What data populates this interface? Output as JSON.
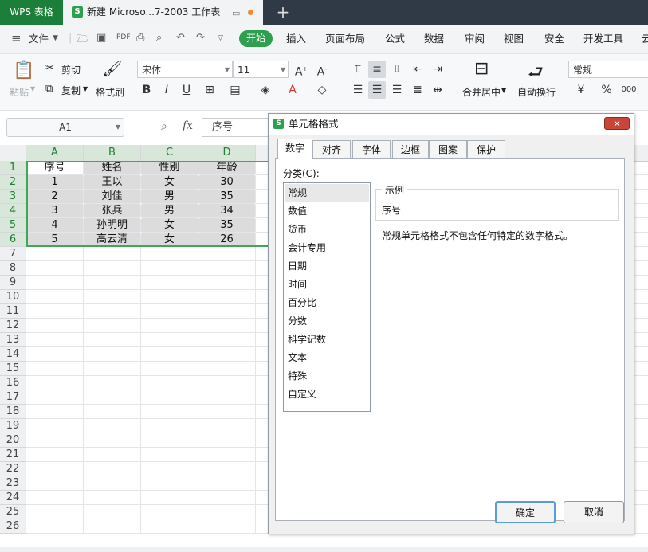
{
  "titlebar": {
    "app_tab": "WPS 表格",
    "doc_tab": "新建 Microso...7-2003 工作表",
    "new_tab_icon": "plus-icon",
    "doc_icon_letter": "S"
  },
  "menubar": {
    "file_label": "文件",
    "start_label": "开始",
    "items": [
      "插入",
      "页面布局",
      "公式",
      "数据",
      "审阅",
      "视图",
      "安全",
      "开发工具",
      "云"
    ]
  },
  "ribbon": {
    "paste_label": "粘贴",
    "cut_label": "剪切",
    "copy_label": "复制",
    "format_painter_label": "格式刷",
    "font_name": "宋体",
    "font_size": "11",
    "merge_center_label": "合并居中",
    "wrap_text_label": "自动换行",
    "number_format": "常规",
    "percent_label": "%"
  },
  "formula_bar": {
    "name_box": "A1",
    "fx_label": "fx",
    "formula_value": "序号"
  },
  "sheet": {
    "columns": [
      "A",
      "B",
      "C",
      "D"
    ],
    "row_numbers": [
      "1",
      "2",
      "3",
      "4",
      "5",
      "6",
      "7",
      "8",
      "9",
      "10",
      "11",
      "12",
      "13",
      "14",
      "15",
      "16",
      "17",
      "18",
      "19",
      "20",
      "21",
      "22",
      "23",
      "24",
      "25",
      "26"
    ],
    "headers": [
      "序号",
      "姓名",
      "性别",
      "年龄"
    ],
    "rows": [
      [
        "1",
        "王以",
        "女",
        "30"
      ],
      [
        "2",
        "刘佳",
        "男",
        "35"
      ],
      [
        "3",
        "张兵",
        "男",
        "34"
      ],
      [
        "4",
        "孙明明",
        "女",
        "35"
      ],
      [
        "5",
        "高云清",
        "女",
        "26"
      ]
    ]
  },
  "dialog": {
    "title": "单元格格式",
    "close_label": "×",
    "tabs": [
      "数字",
      "对齐",
      "字体",
      "边框",
      "图案",
      "保护"
    ],
    "category_label": "分类(C):",
    "categories": [
      "常规",
      "数值",
      "货币",
      "会计专用",
      "日期",
      "时间",
      "百分比",
      "分数",
      "科学记数",
      "文本",
      "特殊",
      "自定义"
    ],
    "sample_label": "示例",
    "sample_value": "序号",
    "description": "常规单元格格式不包含任何特定的数字格式。",
    "ok_label": "确定",
    "cancel_label": "取消"
  },
  "colors": {
    "accent_green": "#2e9f4f",
    "selection_border": "#3fa757",
    "titlebar_bg": "#2f3a46"
  }
}
